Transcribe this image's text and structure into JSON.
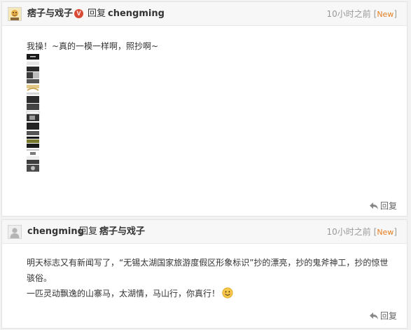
{
  "comments": [
    {
      "user": {
        "name": "痞子与戏子",
        "verified": "V",
        "avatar": "avatar-cartoon-icon"
      },
      "reply_word": "回复",
      "reply_target": "chengming",
      "time": "10小时之前",
      "new_tag": "New",
      "bracket_open": "[",
      "bracket_close": "]",
      "content_lines": [
        "我操！~真的一模一样啊，照抄啊~"
      ],
      "thumbnail_count": 17,
      "action_reply": "回复"
    },
    {
      "user": {
        "name": "chengming",
        "avatar": "default-user-icon"
      },
      "reply_word": "回复",
      "reply_target": "痞子与戏子",
      "time": "10小时之前",
      "new_tag": "New",
      "bracket_open": "[",
      "bracket_close": "]",
      "content_lines": [
        "明天标志又有新闻写了，“无锡太湖国家旅游度假区形象标识”抄的漂亮，抄的鬼斧神工，抄的惊世",
        "骇俗。",
        "一匹灵动飘逸的山寨马，太湖情，马山行，你真行！"
      ],
      "emoji": "smiley-face-icon",
      "action_reply": "回复"
    }
  ],
  "colors": {
    "accent_new": "#e67e22",
    "verified_badge": "#d84a35",
    "time_gray": "#999999"
  }
}
